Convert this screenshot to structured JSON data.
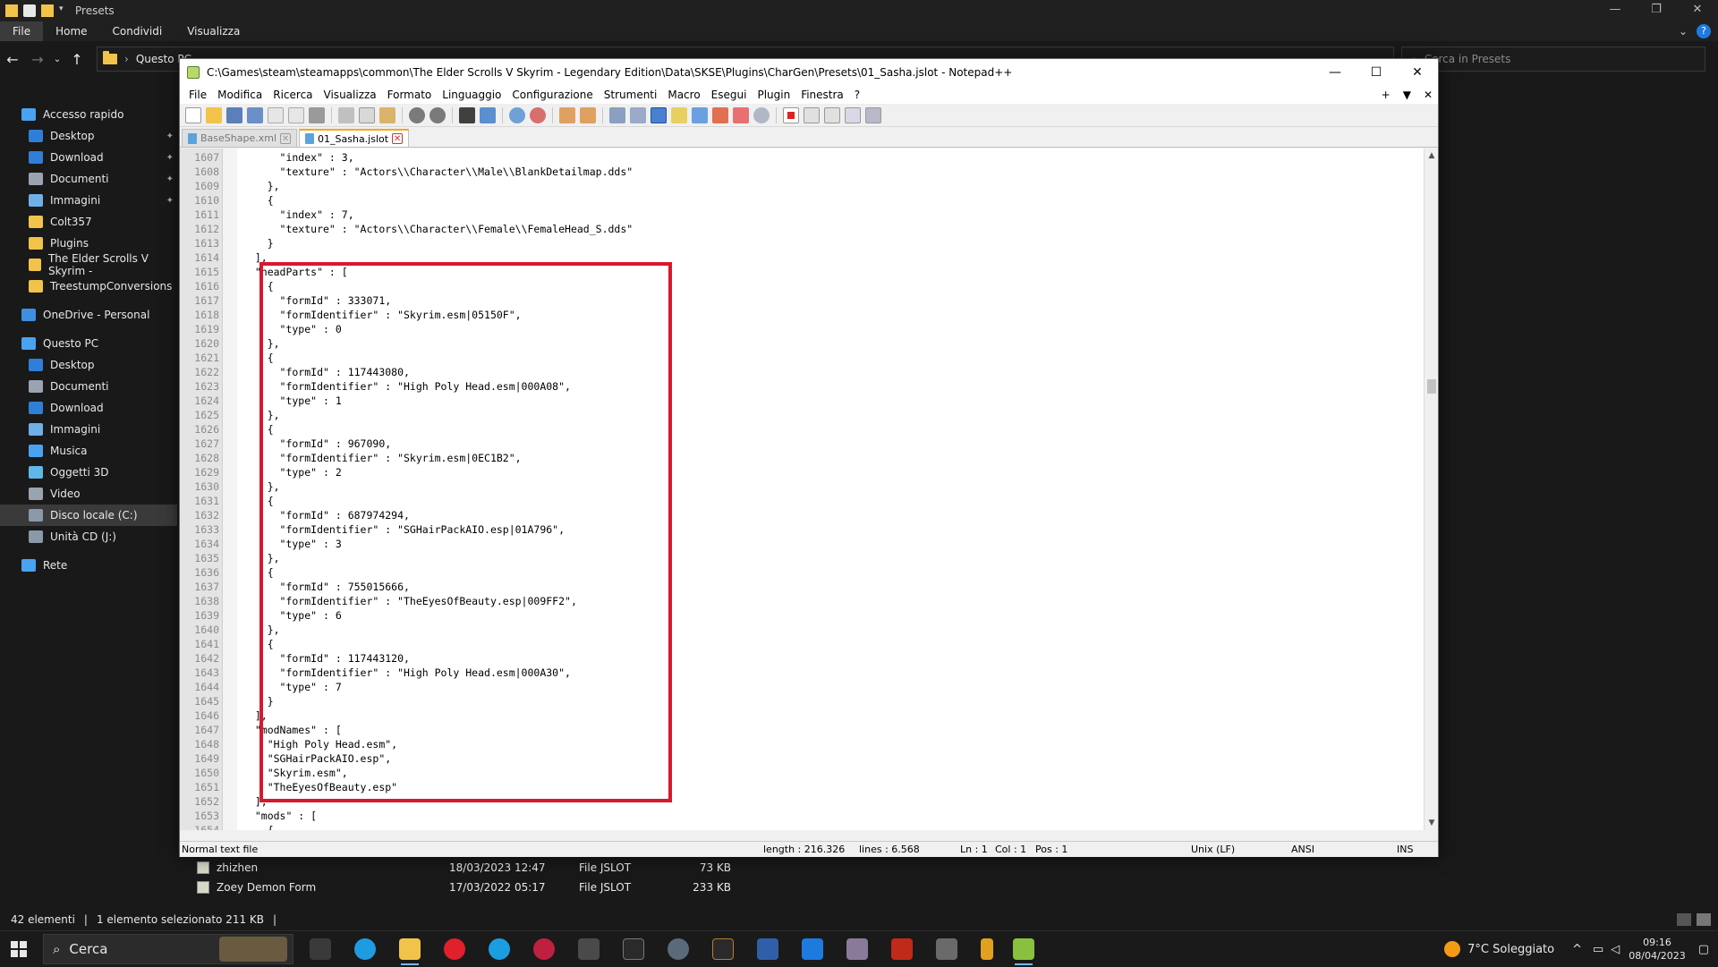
{
  "explorer": {
    "title": "Presets",
    "ribbon_tabs": [
      "File",
      "Home",
      "Condividi",
      "Visualizza"
    ],
    "address_root": "Questo PC",
    "search_placeholder": "Cerca in Presets",
    "nav": [
      {
        "label": "Accesso rapido",
        "color": "#4aa3f0",
        "pinned": false,
        "level": 0
      },
      {
        "label": "Desktop",
        "color": "#2f7fd8",
        "pinned": true,
        "level": 1
      },
      {
        "label": "Download",
        "color": "#2f7fd8",
        "pinned": true,
        "level": 1
      },
      {
        "label": "Documenti",
        "color": "#9aa4b0",
        "pinned": true,
        "level": 1
      },
      {
        "label": "Immagini",
        "color": "#6fb0e8",
        "pinned": true,
        "level": 1
      },
      {
        "label": "Colt357",
        "color": "#f1c34a",
        "pinned": false,
        "level": 1
      },
      {
        "label": "Plugins",
        "color": "#f1c34a",
        "pinned": false,
        "level": 1
      },
      {
        "label": "The Elder Scrolls V Skyrim -",
        "color": "#f1c34a",
        "pinned": false,
        "level": 1
      },
      {
        "label": "TreestumpConversions",
        "color": "#f1c34a",
        "pinned": false,
        "level": 1
      },
      {
        "label": "OneDrive - Personal",
        "color": "#3f8fe0",
        "pinned": false,
        "level": 0
      },
      {
        "label": "Questo PC",
        "color": "#4aa3f0",
        "pinned": false,
        "level": 0
      },
      {
        "label": "Desktop",
        "color": "#2f7fd8",
        "pinned": false,
        "level": 1
      },
      {
        "label": "Documenti",
        "color": "#9aa4b0",
        "pinned": false,
        "level": 1
      },
      {
        "label": "Download",
        "color": "#2f7fd8",
        "pinned": false,
        "level": 1
      },
      {
        "label": "Immagini",
        "color": "#6fb0e8",
        "pinned": false,
        "level": 1
      },
      {
        "label": "Musica",
        "color": "#4aa3f0",
        "pinned": false,
        "level": 1
      },
      {
        "label": "Oggetti 3D",
        "color": "#5fb8e8",
        "pinned": false,
        "level": 1
      },
      {
        "label": "Video",
        "color": "#9aa4b0",
        "pinned": false,
        "level": 1
      },
      {
        "label": "Disco locale (C:)",
        "color": "#8a98a8",
        "pinned": false,
        "level": 1,
        "selected": true
      },
      {
        "label": "Unità CD (J:)",
        "color": "#8a98a8",
        "pinned": false,
        "level": 1
      },
      {
        "label": "Rete",
        "color": "#4aa3f0",
        "pinned": false,
        "level": 0
      }
    ],
    "files": [
      {
        "name": "zhizhen",
        "date": "18/03/2023 12:47",
        "type": "File JSLOT",
        "size": "73 KB"
      },
      {
        "name": "Zoey Demon Form",
        "date": "17/03/2022 05:17",
        "type": "File JSLOT",
        "size": "233 KB"
      }
    ],
    "status": {
      "count": "42 elementi",
      "selected": "1 elemento selezionato  211 KB"
    }
  },
  "notepad": {
    "title": "C:\\Games\\steam\\steamapps\\common\\The Elder Scrolls V Skyrim - Legendary Edition\\Data\\SKSE\\Plugins\\CharGen\\Presets\\01_Sasha.jslot - Notepad++",
    "menu": [
      "File",
      "Modifica",
      "Ricerca",
      "Visualizza",
      "Formato",
      "Linguaggio",
      "Configurazione",
      "Strumenti",
      "Macro",
      "Esegui",
      "Plugin",
      "Finestra",
      "?"
    ],
    "menu_right": [
      "+",
      "▼",
      "✕"
    ],
    "tabs": [
      {
        "label": "BaseShape.xml",
        "active": false
      },
      {
        "label": "01_Sasha.jslot",
        "active": true
      }
    ],
    "lines": [
      {
        "n": "1607",
        "t": "      \"index\" : 3,"
      },
      {
        "n": "1608",
        "t": "      \"texture\" : \"Actors\\\\Character\\\\Male\\\\BlankDetailmap.dds\""
      },
      {
        "n": "1609",
        "t": "    },"
      },
      {
        "n": "1610",
        "t": "    {"
      },
      {
        "n": "1611",
        "t": "      \"index\" : 7,"
      },
      {
        "n": "1612",
        "t": "      \"texture\" : \"Actors\\\\Character\\\\Female\\\\FemaleHead_S.dds\""
      },
      {
        "n": "1613",
        "t": "    }"
      },
      {
        "n": "1614",
        "t": "  ],"
      },
      {
        "n": "1615",
        "t": "  \"headParts\" : ["
      },
      {
        "n": "1616",
        "t": "    {"
      },
      {
        "n": "1617",
        "t": "      \"formId\" : 333071,"
      },
      {
        "n": "1618",
        "t": "      \"formIdentifier\" : \"Skyrim.esm|05150F\","
      },
      {
        "n": "1619",
        "t": "      \"type\" : 0"
      },
      {
        "n": "1620",
        "t": "    },"
      },
      {
        "n": "1621",
        "t": "    {"
      },
      {
        "n": "1622",
        "t": "      \"formId\" : 117443080,"
      },
      {
        "n": "1623",
        "t": "      \"formIdentifier\" : \"High Poly Head.esm|000A08\","
      },
      {
        "n": "1624",
        "t": "      \"type\" : 1"
      },
      {
        "n": "1625",
        "t": "    },"
      },
      {
        "n": "1626",
        "t": "    {"
      },
      {
        "n": "1627",
        "t": "      \"formId\" : 967090,"
      },
      {
        "n": "1628",
        "t": "      \"formIdentifier\" : \"Skyrim.esm|0EC1B2\","
      },
      {
        "n": "1629",
        "t": "      \"type\" : 2"
      },
      {
        "n": "1630",
        "t": "    },"
      },
      {
        "n": "1631",
        "t": "    {"
      },
      {
        "n": "1632",
        "t": "      \"formId\" : 687974294,"
      },
      {
        "n": "1633",
        "t": "      \"formIdentifier\" : \"SGHairPackAIO.esp|01A796\","
      },
      {
        "n": "1634",
        "t": "      \"type\" : 3"
      },
      {
        "n": "1635",
        "t": "    },"
      },
      {
        "n": "1636",
        "t": "    {"
      },
      {
        "n": "1637",
        "t": "      \"formId\" : 755015666,"
      },
      {
        "n": "1638",
        "t": "      \"formIdentifier\" : \"TheEyesOfBeauty.esp|009FF2\","
      },
      {
        "n": "1639",
        "t": "      \"type\" : 6"
      },
      {
        "n": "1640",
        "t": "    },"
      },
      {
        "n": "1641",
        "t": "    {"
      },
      {
        "n": "1642",
        "t": "      \"formId\" : 117443120,"
      },
      {
        "n": "1643",
        "t": "      \"formIdentifier\" : \"High Poly Head.esm|000A30\","
      },
      {
        "n": "1644",
        "t": "      \"type\" : 7"
      },
      {
        "n": "1645",
        "t": "    }"
      },
      {
        "n": "1646",
        "t": "  ],"
      },
      {
        "n": "1647",
        "t": "  \"modNames\" : ["
      },
      {
        "n": "1648",
        "t": "    \"High Poly Head.esm\","
      },
      {
        "n": "1649",
        "t": "    \"SGHairPackAIO.esp\","
      },
      {
        "n": "1650",
        "t": "    \"Skyrim.esm\","
      },
      {
        "n": "1651",
        "t": "    \"TheEyesOfBeauty.esp\""
      },
      {
        "n": "1652",
        "t": "  ],"
      },
      {
        "n": "1653",
        "t": "  \"mods\" : ["
      },
      {
        "n": "1654",
        "t": "    {"
      }
    ],
    "status": {
      "type": "Normal text file",
      "length": "length : 216.326",
      "lines": "lines : 6.568",
      "ln": "Ln : 1",
      "col": "Col : 1",
      "pos": "Pos : 1",
      "eol": "Unix (LF)",
      "enc": "ANSI",
      "mode": "INS"
    },
    "highlight_color": "#d9182e"
  },
  "taskbar": {
    "search_label": "Cerca",
    "weather": "7°C  Soleggiato",
    "time": "09:16",
    "date": "08/04/2023"
  }
}
